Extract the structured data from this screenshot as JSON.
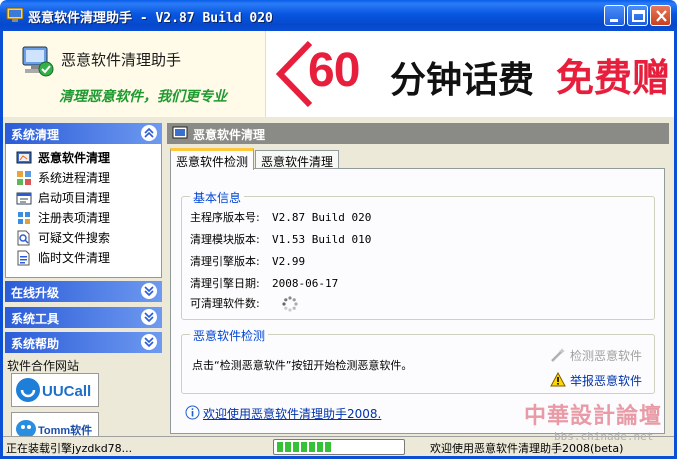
{
  "window": {
    "title": "恶意软件清理助手 - V2.87 Build 020",
    "buttons": {
      "minimize": "minimize",
      "maximize": "maximize",
      "close": "close"
    }
  },
  "header": {
    "app_name": "恶意软件清理助手",
    "slogan": "清理恶意软件，我们更专业",
    "ad": {
      "number": "60",
      "text1": "分钟话费",
      "text2": "免费赠"
    }
  },
  "sidebar": {
    "sections": [
      {
        "label": "系统清理",
        "state": "expanded"
      },
      {
        "label": "在线升级",
        "state": "collapsed"
      },
      {
        "label": "系统工具",
        "state": "collapsed"
      },
      {
        "label": "系统帮助",
        "state": "collapsed"
      }
    ],
    "items": [
      {
        "label": "恶意软件清理",
        "icon": "scan-icon",
        "selected": true
      },
      {
        "label": "系统进程清理",
        "icon": "process-icon"
      },
      {
        "label": "启动项目清理",
        "icon": "startup-icon"
      },
      {
        "label": "注册表项清理",
        "icon": "registry-icon"
      },
      {
        "label": "可疑文件搜索",
        "icon": "file-search-icon"
      },
      {
        "label": "临时文件清理",
        "icon": "temp-file-icon"
      }
    ],
    "partners_title": "软件合作网站",
    "partners": [
      {
        "name": "UUCall"
      },
      {
        "name": "Tomm软件"
      }
    ]
  },
  "main": {
    "panel_title": "恶意软件清理",
    "tabs": [
      {
        "label": "恶意软件检测",
        "active": true
      },
      {
        "label": "恶意软件清理",
        "active": false
      }
    ],
    "basic_info": {
      "title": "基本信息",
      "rows": [
        {
          "label": "主程序版本号:",
          "value": "V2.87 Build 020"
        },
        {
          "label": "清理模块版本:",
          "value": "V1.53 Build 010"
        },
        {
          "label": "清理引擎版本:",
          "value": "V2.99"
        },
        {
          "label": "清理引擎日期:",
          "value": "2008-06-17"
        },
        {
          "label": "可清理软件数:",
          "value": ""
        }
      ]
    },
    "detect": {
      "title": "恶意软件检测",
      "message": "点击“检测恶意软件”按钮开始检测恶意软件。",
      "detect_button": "检测恶意软件",
      "report_button": "举报恶意软件"
    },
    "welcome_link": "欢迎使用恶意软件清理助手2008."
  },
  "status": {
    "left": "正在装载引擎jyzdkd78...",
    "progress_blocks": 7,
    "right": "欢迎使用恶意软件清理助手2008(beta)"
  },
  "watermark": {
    "text": "中華設計論壇",
    "url": "bbs.chinade.net"
  },
  "colors": {
    "title_bar": "#0a5ee8",
    "section_header": "#2b5cd8",
    "panel_header": "#8a8a86",
    "link": "#0033aa",
    "group_title": "#0046d5",
    "ad_red": "#e81f3c",
    "slogan_green": "#1e9a30",
    "progress": "#37c137"
  }
}
